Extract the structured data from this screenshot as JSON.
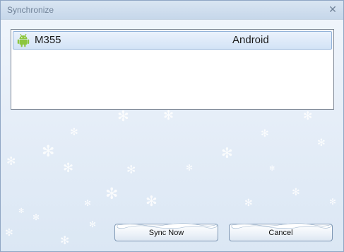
{
  "window": {
    "title": "Synchronize",
    "close_symbol": "✕"
  },
  "devices": [
    {
      "name": "M355",
      "os": "Android",
      "icon": "android-icon"
    }
  ],
  "buttons": {
    "sync_label": "Sync Now",
    "cancel_label": "Cancel"
  },
  "colors": {
    "background": "#e6eef8",
    "row_highlight": "#d3e3f6",
    "android_green": "#8cc63e"
  }
}
